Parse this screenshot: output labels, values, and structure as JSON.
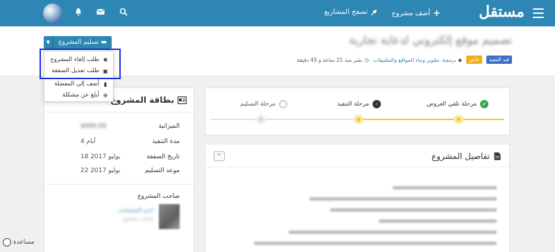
{
  "nav": {
    "logo": "مستقل",
    "add_project": "أضف مشروع",
    "browse_projects": "تصفح المشاريع",
    "icons": [
      "menu-icon",
      "plus-icon",
      "rocket-icon",
      "search-icon",
      "envelope-icon",
      "bell-icon",
      "avatar"
    ]
  },
  "project": {
    "title": "تصميم موقع إلكتروني لدعاية تجارية",
    "badges": {
      "status": "قيد التنفيذ",
      "type": "خاص"
    },
    "category": "برمجة، تطوير وبناء المواقع والتطبيقات",
    "published": "نشر منذ 21 ساعة و 45 دقيقة"
  },
  "deliver_button": "تسليم المشروع",
  "dropdown": {
    "items": [
      {
        "label": "طلب إلغاء المشروع",
        "icon": "times-icon"
      },
      {
        "label": "طلب تعديل الصفقة",
        "icon": "money-icon"
      },
      {
        "label": "أضف إلى المفضلة",
        "icon": "bookmark-icon"
      },
      {
        "label": "أبلغ عن مشكلة",
        "icon": "lifebuoy-icon"
      }
    ]
  },
  "card": {
    "title": "بطاقة المشروع",
    "rows": [
      {
        "label": "الميزانية",
        "value": "$000.00"
      },
      {
        "label": "مدة التنفيذ",
        "value": "4 أيام"
      },
      {
        "label": "تاريخ الصفقة",
        "value": "18 يوليو 2017"
      },
      {
        "label": "موعد التسليم",
        "value": "22 يوليو 2017"
      }
    ],
    "owner_label": "صاحب المشروع",
    "owner_name": "اسم المستخدم",
    "owner_sub": "صاحب مشاريع"
  },
  "progress": {
    "steps": [
      "مرحلة تلقي العروض",
      "مرحلة التنفيذ",
      "مرحلة التسليم"
    ],
    "current_step": 2,
    "fill_fraction": 0.5
  },
  "details": {
    "title": "تفاصيل المشروع",
    "collapse": "^"
  },
  "help": "مساعدة",
  "colors": {
    "primary": "#2d86b3",
    "accent": "#f5c43c",
    "success": "#3aa44a",
    "dark": "#333333",
    "highlight": "#1a2ed6"
  }
}
